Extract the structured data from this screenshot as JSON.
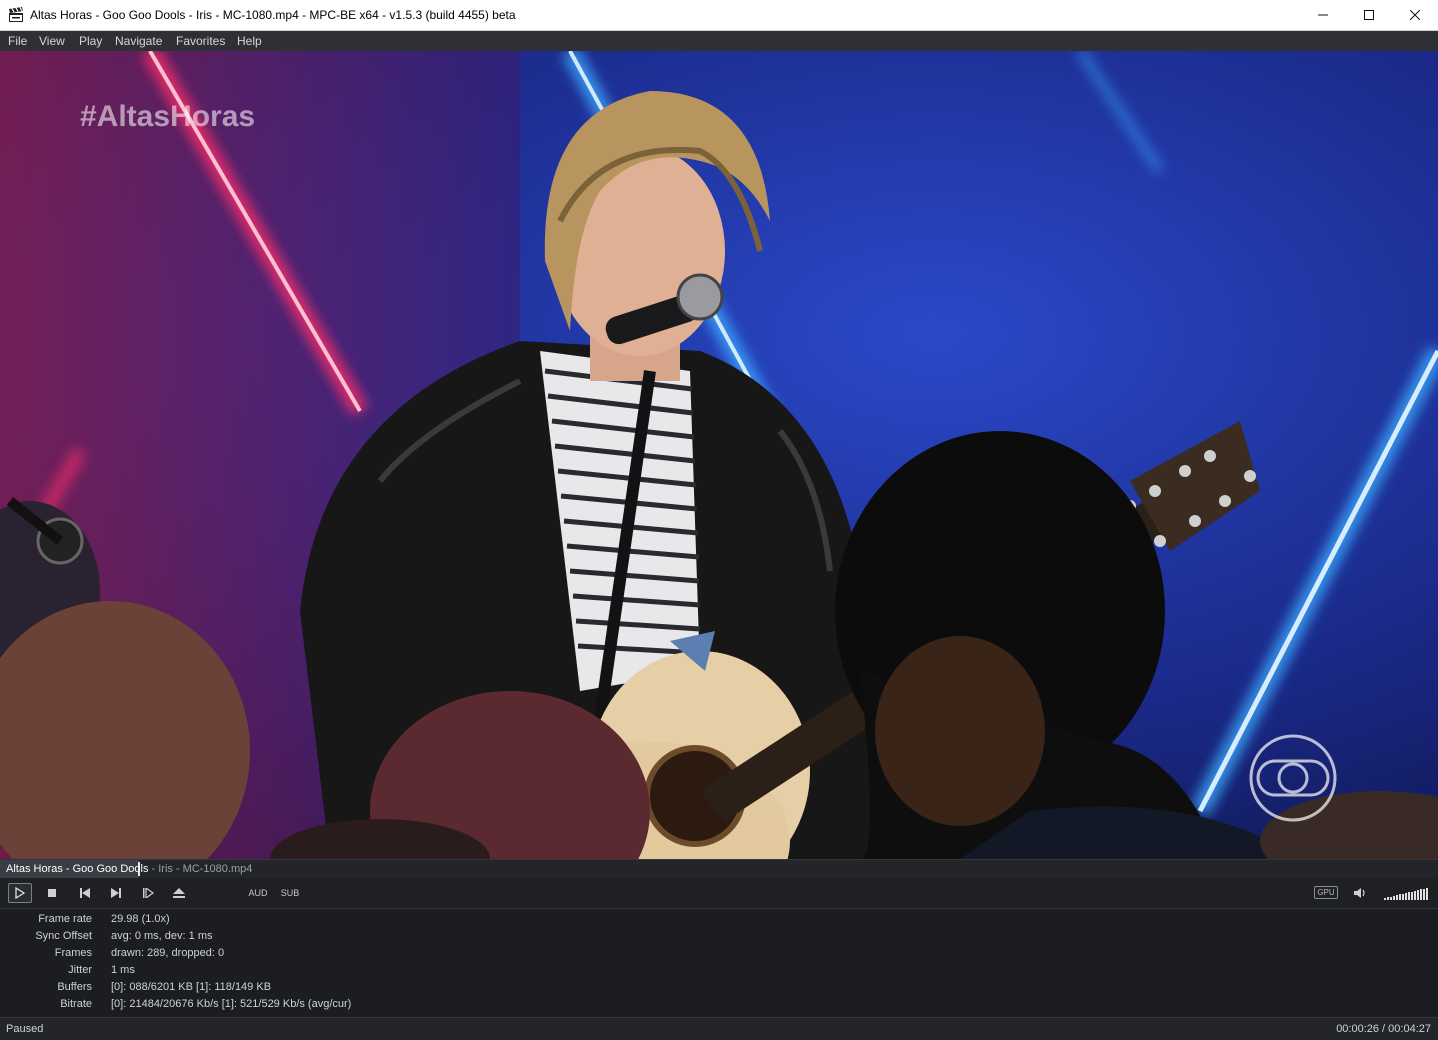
{
  "window": {
    "title": "Altas Horas - Goo Goo Dools - Iris - MC-1080.mp4 - MPC-BE x64 - v1.5.3 (build 4455) beta",
    "icon": "clapperboard-icon",
    "controls": [
      "minimize-icon",
      "maximize-icon",
      "close-icon"
    ]
  },
  "menu": {
    "file": "File",
    "view": "View",
    "play": "Play",
    "navigate": "Navigate",
    "favorites": "Favorites",
    "help": "Help"
  },
  "video": {
    "hashtag": "#AltasHoras",
    "logo": "globo-logo",
    "colors": {
      "background": "#16205e",
      "pink_neon": "#ff2f6a",
      "blue_neon": "#3aa8ff"
    }
  },
  "now_playing": {
    "highlighted": "Altas Horas - Goo Goo Dools",
    "rest": " - Iris - MC-1080.mp4",
    "position_fraction": 0.097
  },
  "toolbar": {
    "play": "play-icon",
    "stop": "stop-icon",
    "prev": "skip-back-icon",
    "next": "skip-forward-icon",
    "frame_step": "frame-step-icon",
    "eject": "eject-icon",
    "aud": "AUD",
    "sub": "SUB",
    "gpu": "GPU",
    "volume_icon": "speaker-icon",
    "volume_level": 1.0
  },
  "stats": [
    {
      "label": "Frame rate",
      "value": "29.98  (1.0x)"
    },
    {
      "label": "Sync Offset",
      "value": "avg: 0 ms, dev: 1 ms"
    },
    {
      "label": "Frames",
      "value": "drawn: 289, dropped: 0"
    },
    {
      "label": "Jitter",
      "value": "1 ms"
    },
    {
      "label": "Buffers",
      "value": "[0]: 088/6201 KB [1]: 118/149 KB"
    },
    {
      "label": "Bitrate",
      "value": "[0]: 21484/20676 Kb/s [1]: 521/529 Kb/s (avg/cur)"
    }
  ],
  "status": {
    "state": "Paused",
    "time": "00:00:26 / 00:04:27"
  }
}
